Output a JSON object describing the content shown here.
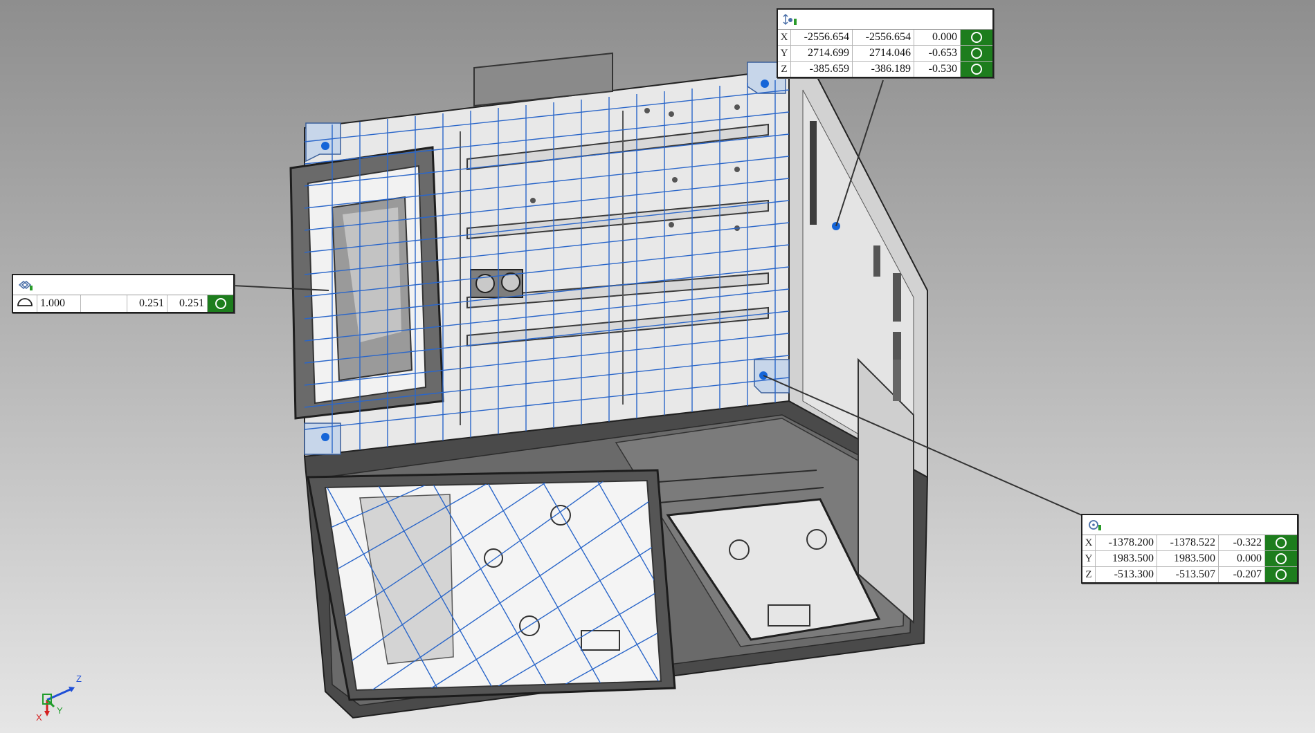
{
  "viewport": {
    "background_top": "#8e8e8e",
    "background_bottom": "#e6e6e6",
    "model_grid_color": "#2a66c9",
    "probe_point_color": "#1565d8"
  },
  "panels": {
    "left": {
      "icon": "flatness-icon",
      "mode_icon": "half-circle-icon",
      "values": [
        "1.000",
        "",
        "0.251",
        "0.251"
      ],
      "status_color": "#1d7d1d"
    },
    "top": {
      "icon": "point-deviation-icon",
      "rows": [
        {
          "axis": "X",
          "measured": "-2556.654",
          "nominal": "-2556.654",
          "deviation": "0.000"
        },
        {
          "axis": "Y",
          "measured": "2714.699",
          "nominal": "2714.046",
          "deviation": "-0.653"
        },
        {
          "axis": "Z",
          "measured": "-385.659",
          "nominal": "-386.189",
          "deviation": "-0.530"
        }
      ],
      "status_color": "#1d7d1d"
    },
    "right": {
      "icon": "circle-position-icon",
      "rows": [
        {
          "axis": "X",
          "measured": "-1378.200",
          "nominal": "-1378.522",
          "deviation": "-0.322"
        },
        {
          "axis": "Y",
          "measured": "1983.500",
          "nominal": "1983.500",
          "deviation": "0.000"
        },
        {
          "axis": "Z",
          "measured": "-513.300",
          "nominal": "-513.507",
          "deviation": "-0.207"
        }
      ],
      "status_color": "#1d7d1d"
    }
  },
  "triad": {
    "z": "Z",
    "y": "Y",
    "x": "X",
    "z_color": "#1f4fd6",
    "y_color": "#1f9c2a",
    "x_color": "#d42020"
  }
}
